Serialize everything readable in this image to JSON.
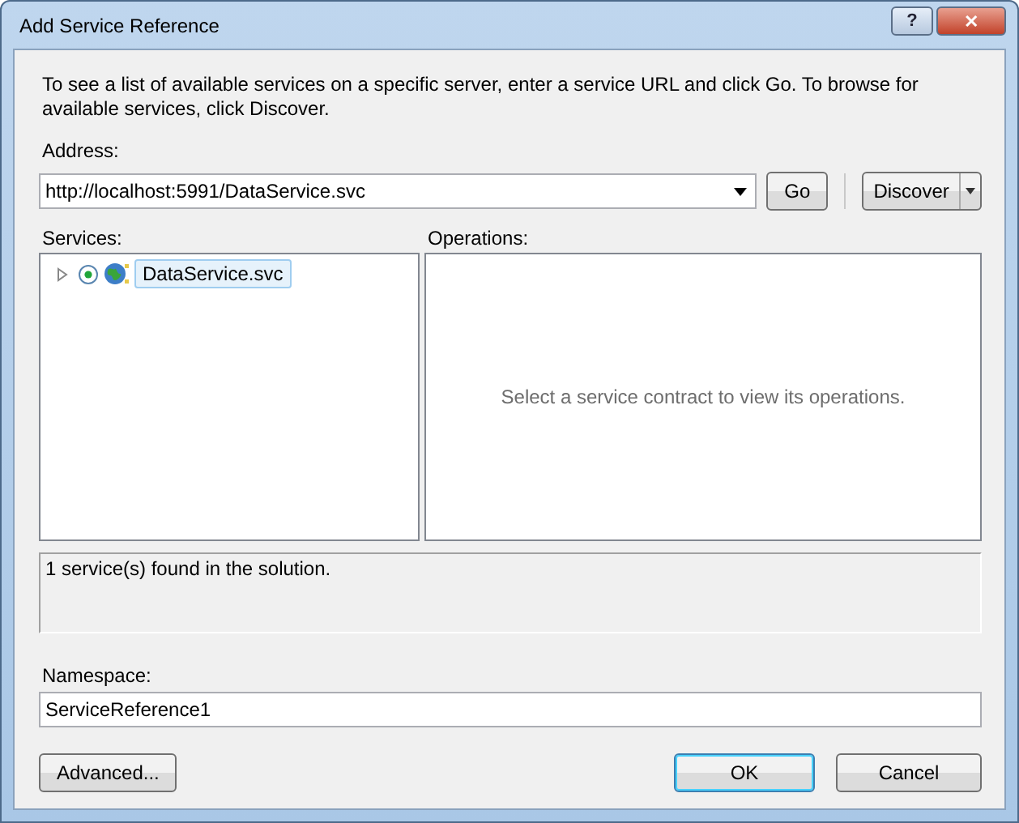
{
  "window": {
    "title": "Add Service Reference",
    "controls": [
      "?",
      "✕"
    ]
  },
  "intro": "To see a list of available services on a specific server, enter a service URL and click Go. To browse for available services, click Discover.",
  "address": {
    "label": "Address:",
    "value": "http://localhost:5991/DataService.svc",
    "go": "Go",
    "discover": "Discover"
  },
  "services": {
    "label": "Services:",
    "items": [
      {
        "label": "DataService.svc",
        "selected": true,
        "expanded": false
      }
    ]
  },
  "operations": {
    "label": "Operations:",
    "message": "Select a service contract to view its operations."
  },
  "status": "1 service(s) found in the solution.",
  "namespace": {
    "label": "Namespace:",
    "value": "ServiceReference1"
  },
  "buttons": [
    {
      "label": "Advanced...",
      "kind": "left",
      "default": false
    },
    {
      "label": "OK",
      "kind": "right",
      "default": true
    },
    {
      "label": "Cancel",
      "kind": "right",
      "default": false
    }
  ]
}
